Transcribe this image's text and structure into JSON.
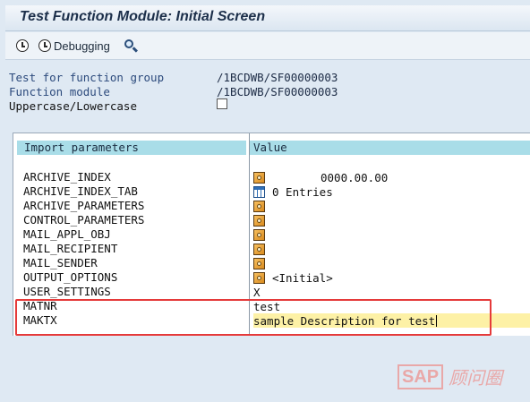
{
  "window": {
    "title": "Test Function Module: Initial Screen"
  },
  "toolbar": {
    "debugging_label": "Debugging"
  },
  "info": {
    "group_label": "Test for function group",
    "group_value": "/1BCDWB/SF00000003",
    "module_label": "Function module",
    "module_value": "/1BCDWB/SF00000003",
    "case_label": "Uppercase/Lowercase"
  },
  "table": {
    "col_import": "Import parameters",
    "col_value": "Value",
    "rows": [
      {
        "name": "ARCHIVE_INDEX",
        "value": "0000.00.00"
      },
      {
        "name": "ARCHIVE_INDEX_TAB",
        "value": "0 Entries"
      },
      {
        "name": "ARCHIVE_PARAMETERS",
        "value": ""
      },
      {
        "name": "CONTROL_PARAMETERS",
        "value": ""
      },
      {
        "name": "MAIL_APPL_OBJ",
        "value": ""
      },
      {
        "name": "MAIL_RECIPIENT",
        "value": ""
      },
      {
        "name": "MAIL_SENDER",
        "value": ""
      },
      {
        "name": "OUTPUT_OPTIONS",
        "value": "<Initial>"
      },
      {
        "name": "USER_SETTINGS",
        "value": "X"
      },
      {
        "name": "MATNR",
        "value": "test"
      },
      {
        "name": "MAKTX",
        "value": "sample Description for test"
      }
    ]
  },
  "watermark": {
    "logo": "SAP",
    "text": "顾问圈"
  },
  "colors": {
    "highlight": "#e53a3a",
    "header": "#a9dde8",
    "input_active": "#fdf1a6"
  }
}
